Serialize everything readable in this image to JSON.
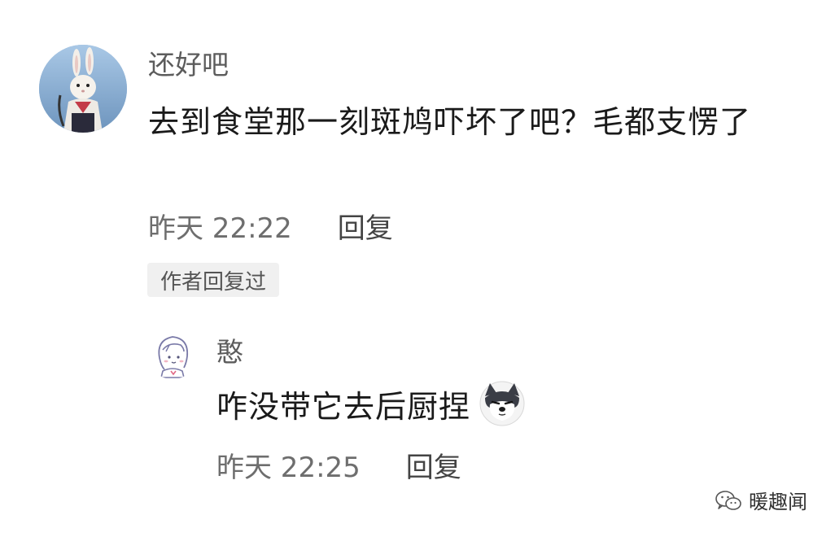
{
  "comment": {
    "username": "还好吧",
    "text": "去到食堂那一刻斑鸠吓坏了吧？毛都支愣了",
    "time": "昨天 22:22",
    "reply_label": "回复",
    "author_badge": "作者回复过",
    "avatar_icon": "rabbit-figure-avatar"
  },
  "reply": {
    "username": "憨",
    "text": "咋没带它去后厨捏",
    "emoji_icon": "doge-emoji-icon",
    "time": "昨天 22:25",
    "reply_label": "回复",
    "avatar_icon": "sketch-girl-avatar"
  },
  "watermark": {
    "text": "暖趣闻",
    "icon": "wechat-icon"
  },
  "colors": {
    "text_primary": "#1a1a1a",
    "text_secondary": "#6e6e6e",
    "badge_bg": "#f0f0f0"
  }
}
